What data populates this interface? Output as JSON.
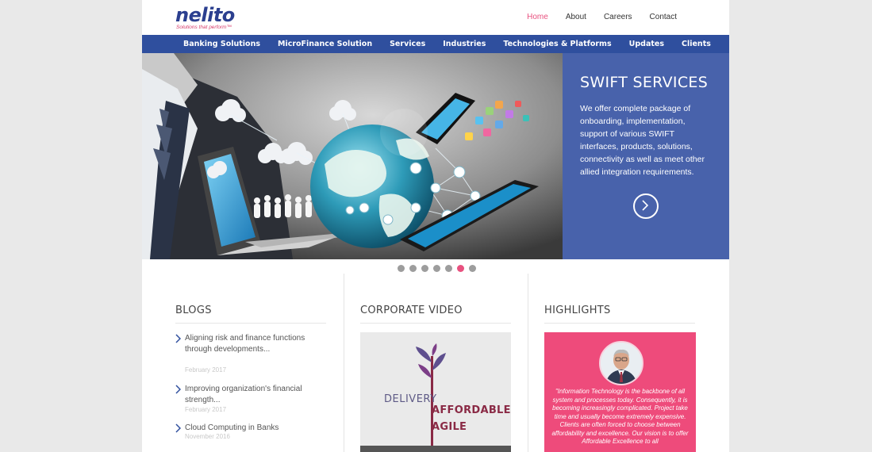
{
  "header": {
    "logo_text": "nelito",
    "logo_tagline": "Solutions that perform™",
    "nav": [
      "Home",
      "About",
      "Careers",
      "Contact"
    ],
    "active_nav": "Home"
  },
  "main_nav": [
    "Banking Solutions",
    "MicroFinance Solution",
    "Services",
    "Industries",
    "Technologies & Platforms",
    "Updates",
    "Clients"
  ],
  "hero": {
    "title": "SWIFT SERVICES",
    "text": "We offer complete package of onboarding, implementation, support of various SWIFT interfaces, products, solutions, connectivity as well as meet other allied integration requirements.",
    "next_icon": "chevron-right-icon",
    "slide_count": 7,
    "active_slide": 6
  },
  "blogs": {
    "title": "BLOGS",
    "items": [
      {
        "title": "Aligning risk and finance functions through developments...",
        "date": "February 2017"
      },
      {
        "title": "Improving organization's financial strength...",
        "date": "February 2017"
      },
      {
        "title": "Cloud Computing in Banks",
        "date": "November 2016"
      }
    ]
  },
  "video": {
    "title": "CORPORATE VIDEO",
    "delivery": "DELIVERY",
    "affordable": "AFFORDABLE",
    "agile": "AGILE"
  },
  "highlights": {
    "title": "HIGHLIGHTS",
    "quote": "\"Information Technology is the backbone of all system and processes today. Consequently, it is becoming increasingly complicated. Project take time and usually become extremely expensive. Clients are often forced to choose between affordability and excellence. Our vision is to offer Affordable Excellence to all"
  },
  "colors": {
    "brand_blue": "#2f4f9e",
    "panel_blue": "#4862ab",
    "accent_pink": "#e8517f",
    "highlight_pink": "#ee4b7b"
  }
}
